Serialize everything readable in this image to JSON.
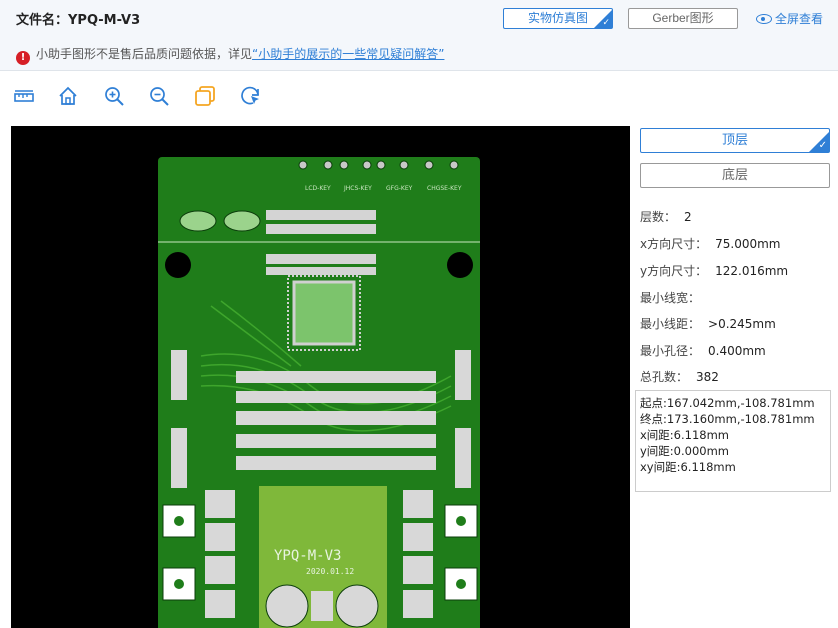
{
  "header": {
    "file_title": "文件名：YPQ-M-V3",
    "view_sim_label": "实物仿真图",
    "view_gerber_label": "Gerber图形",
    "fullscreen_label": "全屏查看",
    "warning_text": "小助手图形不是售后品质问题依据，详见",
    "warning_link": "“小助手的展示的一些常见疑问解答”"
  },
  "toolbar": {
    "tools": [
      "ruler-icon",
      "home-icon",
      "zoom-in-icon",
      "zoom-out-icon",
      "layers-icon",
      "refresh-cursor-icon"
    ],
    "accent_color": "#2f7fd6",
    "highlight_color": "#f5a623"
  },
  "board": {
    "silk_title": "YPQ-M-V3",
    "silk_date": "2020.01.12",
    "top_connectors": [
      "LCD-KEY",
      "JHCS-KEY",
      "GFG-KEY",
      "CHGSE-KEY"
    ],
    "board_color": "#1f7d1a",
    "trace_color": "#3ea52c"
  },
  "side": {
    "top_layer_label": "顶层",
    "bottom_layer_label": "底层",
    "stats": [
      {
        "label": "层数：",
        "value": "2"
      },
      {
        "label": "x方向尺寸：",
        "value": "75.000mm"
      },
      {
        "label": "y方向尺寸：",
        "value": "122.016mm"
      },
      {
        "label": "最小线宽：",
        "value": ""
      },
      {
        "label": "最小线距：",
        "value": ">0.245mm"
      },
      {
        "label": "最小孔径：",
        "value": "0.400mm"
      },
      {
        "label": "总孔数：",
        "value": "382"
      }
    ],
    "measure": [
      "起点:167.042mm,-108.781mm",
      "终点:173.160mm,-108.781mm",
      "x间距:6.118mm",
      "y间距:0.000mm",
      "xy间距:6.118mm"
    ]
  }
}
